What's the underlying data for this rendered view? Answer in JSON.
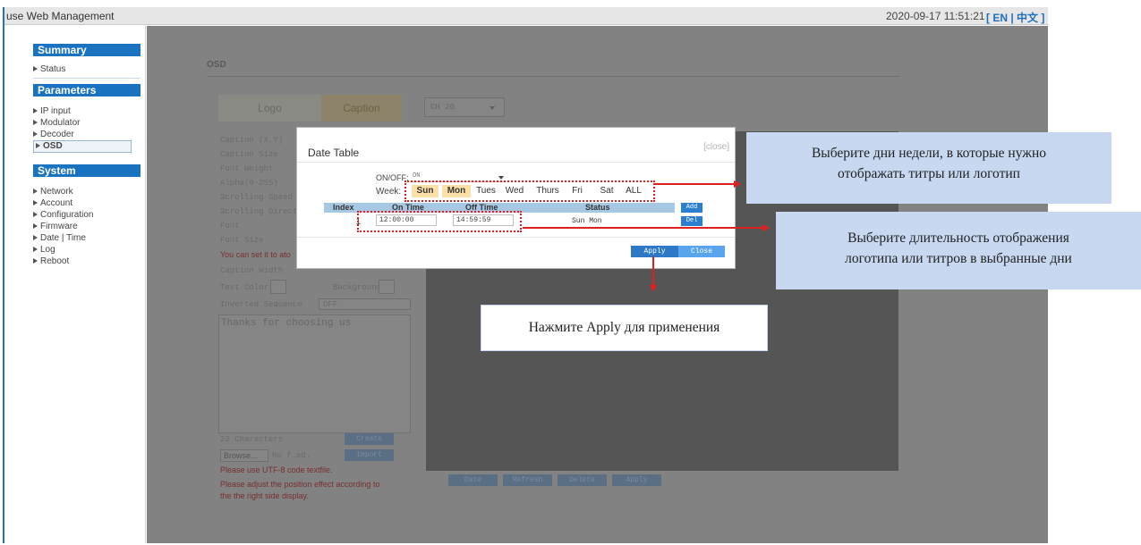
{
  "app": {
    "title": "use Web Management",
    "datetime": "2020-09-17 11:51:21",
    "language_switch": "[ EN | 中文 ]"
  },
  "sidebar": {
    "sections": [
      {
        "title": "Summary",
        "items": [
          "Status"
        ]
      },
      {
        "title": "Parameters",
        "items": [
          "IP input",
          "Modulator",
          "Decoder",
          "OSD"
        ]
      },
      {
        "title": "System",
        "items": [
          "Network",
          "Account",
          "Configuration",
          "Firmware",
          "Date | Time",
          "Log",
          "Reboot"
        ]
      }
    ],
    "active_item": "OSD"
  },
  "background": {
    "page_title": "OSD",
    "tabs": [
      "Logo",
      "Caption"
    ],
    "active_tab": "Caption",
    "channel": "CH 20",
    "fields": [
      "Caption (X,Y)",
      "Caption Size",
      "Font Weight",
      "Alpha(0-255)",
      "Scrolling Speed",
      "Scrolling Direct",
      "Font",
      "Font Size"
    ],
    "hint_red": "You can set it to ato",
    "caption_width": "Caption Width",
    "text_color": "Text Color",
    "background_label": "Background:",
    "inverted_sequence": "Inverted Sequence",
    "inverted_value": "OFF",
    "textarea": "Thanks for choosing us",
    "char_count": "22 Characters",
    "create": "Create",
    "browse": "Browse...",
    "no_file": "No f…ed.",
    "import": "Import",
    "utf8_note": "Please use UTF-8 code textfile.",
    "adjust_note_1": "Please adjust the position effect according to",
    "adjust_note_2": "the the right side display.",
    "bottom_buttons": [
      "Date",
      "Refresh",
      "Delete",
      "Apply"
    ]
  },
  "dialog": {
    "title": "Date Table",
    "close": "[close]",
    "onoff_label": "ON/OFF:",
    "onoff_value": "ON",
    "week_label": "Week:",
    "days": [
      {
        "label": "Sun",
        "selected": true
      },
      {
        "label": "Mon",
        "selected": true
      },
      {
        "label": "Tues",
        "selected": false
      },
      {
        "label": "Wed",
        "selected": false
      },
      {
        "label": "Thurs",
        "selected": false
      },
      {
        "label": "Fri",
        "selected": false
      },
      {
        "label": "Sat",
        "selected": false
      },
      {
        "label": "ALL",
        "selected": false
      }
    ],
    "columns": [
      "Index",
      "On Time",
      "Off Time",
      "Status"
    ],
    "add": "Add",
    "rows": [
      {
        "index": "1",
        "on_time": "12:00:00",
        "off_time": "14:59:59",
        "status": "Sun Mon",
        "del": "Del"
      }
    ],
    "apply": "Apply",
    "close_button": "Close"
  },
  "callouts": {
    "days": "Выберите дни недели, в которые нужно отображать титры или логотип",
    "days_line1": "Выберите дни недели, в которые нужно",
    "days_line2": "отображать титры или логотип",
    "duration_line1": "Выберите длительность отображения",
    "duration_line2": "логотипа или титров в выбранные дни",
    "apply": "Нажмите Apply для применения"
  },
  "colors": {
    "accent": "#1a73c0",
    "selected_day": "#fbe1a8",
    "annotation_red": "#e02020",
    "callout_blue": "#c7d8f0"
  }
}
